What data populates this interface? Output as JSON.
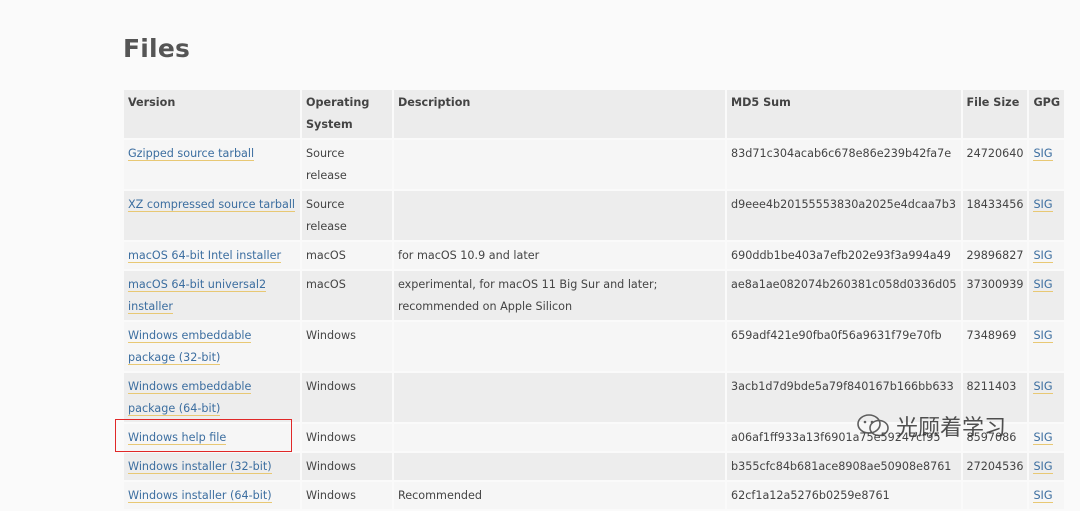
{
  "heading": "Files",
  "headers": {
    "version": "Version",
    "os": "Operating System",
    "description": "Description",
    "md5": "MD5 Sum",
    "size": "File Size",
    "gpg": "GPG"
  },
  "rows": [
    {
      "version": "Gzipped source tarball",
      "os": "Source release",
      "description": "",
      "md5": "83d71c304acab6c678e86e239b42fa7e",
      "size": "24720640",
      "gpg": "SIG"
    },
    {
      "version": "XZ compressed source tarball",
      "os": "Source release",
      "description": "",
      "md5": "d9eee4b20155553830a2025e4dcaa7b3",
      "size": "18433456",
      "gpg": "SIG"
    },
    {
      "version": "macOS 64-bit Intel installer",
      "os": "macOS",
      "description": "for macOS 10.9 and later",
      "md5": "690ddb1be403a7efb202e93f3a994a49",
      "size": "29896827",
      "gpg": "SIG"
    },
    {
      "version": "macOS 64-bit universal2 installer",
      "os": "macOS",
      "description": "experimental, for macOS 11 Big Sur and later; recommended on Apple Silicon",
      "md5": "ae8a1ae082074b260381c058d0336d05",
      "size": "37300939",
      "gpg": "SIG"
    },
    {
      "version": "Windows embeddable package (32-bit)",
      "os": "Windows",
      "description": "",
      "md5": "659adf421e90fba0f56a9631f79e70fb",
      "size": "7348969",
      "gpg": "SIG"
    },
    {
      "version": "Windows embeddable package (64-bit)",
      "os": "Windows",
      "description": "",
      "md5": "3acb1d7d9bde5a79f840167b166bb633",
      "size": "8211403",
      "gpg": "SIG"
    },
    {
      "version": "Windows help file",
      "os": "Windows",
      "description": "",
      "md5": "a06af1ff933a13f6901a75e59247cf95",
      "size": "8597086",
      "gpg": "SIG"
    },
    {
      "version": "Windows installer (32-bit)",
      "os": "Windows",
      "description": "",
      "md5": "b355cfc84b681ace8908ae50908e8761",
      "size": "27204536",
      "gpg": "SIG"
    },
    {
      "version": "Windows installer (64-bit)",
      "os": "Windows",
      "description": "Recommended",
      "md5": "62cf1a12a5276b0259e8761",
      "size": "",
      "gpg": "SIG"
    }
  ],
  "watermark": "光顾着学习",
  "colors": {
    "link": "#3c6ea0",
    "link_underline": "#e8c874",
    "highlight_box": "#e02828"
  }
}
